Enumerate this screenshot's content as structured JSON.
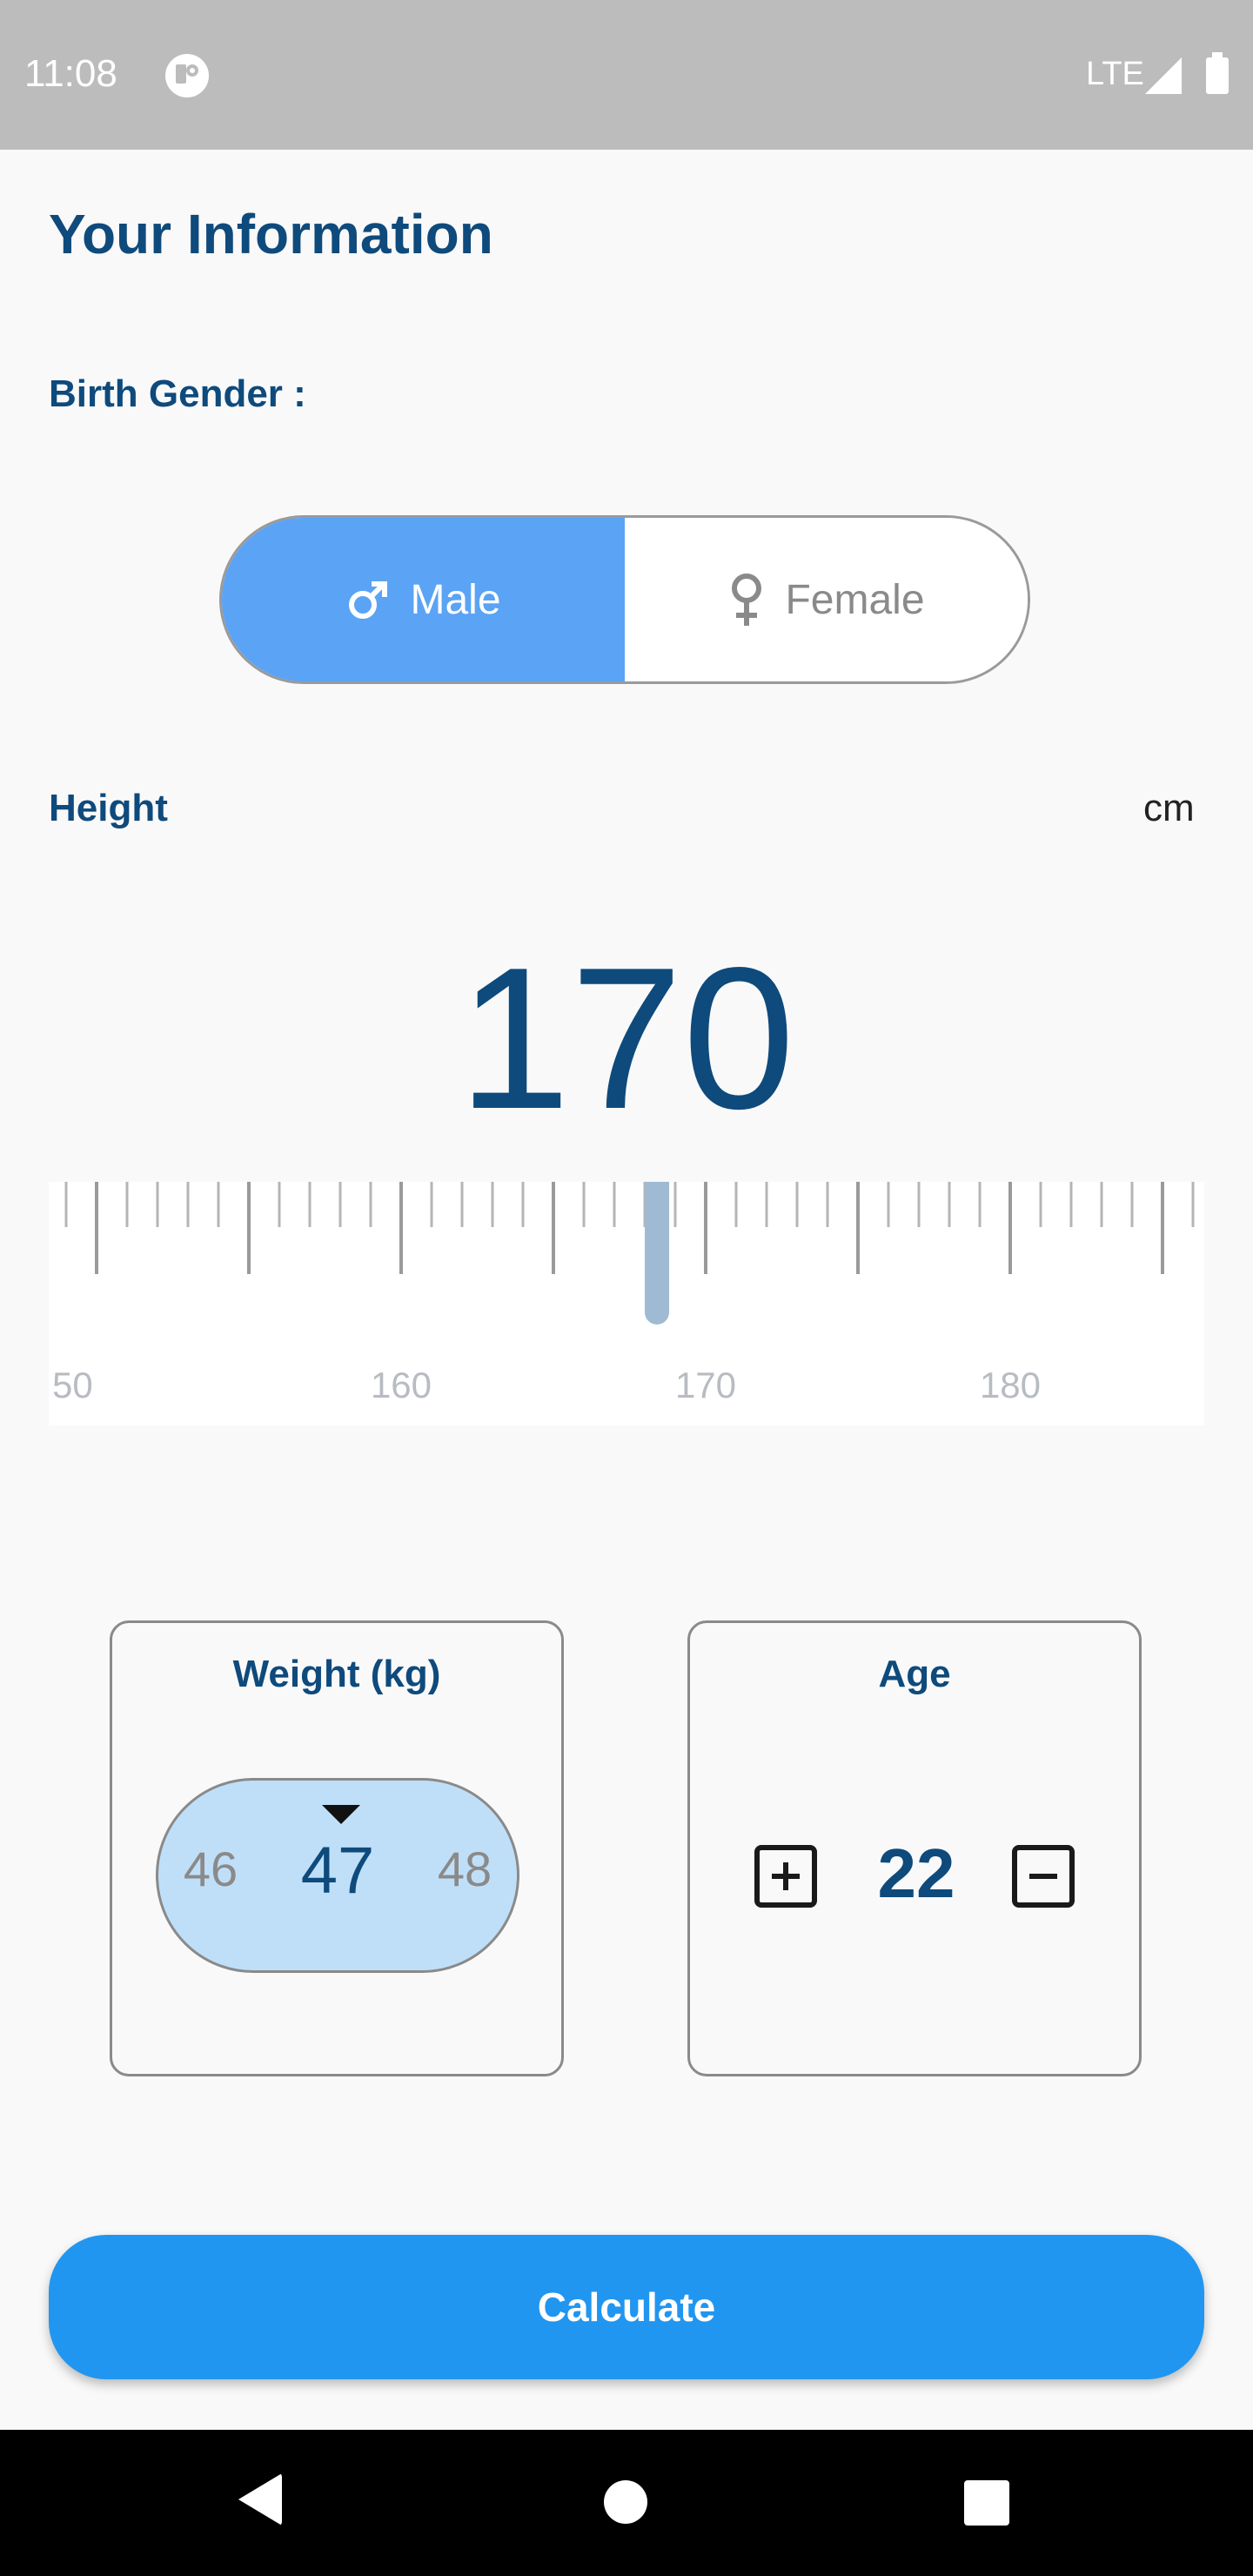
{
  "status_bar": {
    "time": "11:08",
    "network": "LTE",
    "icons": [
      "app-notification-icon",
      "signal-icon",
      "battery-icon"
    ]
  },
  "page": {
    "title": "Your Information"
  },
  "gender": {
    "label": "Birth Gender :",
    "selected": "Male",
    "options": [
      {
        "label": "Male",
        "icon": "male-symbol-icon"
      },
      {
        "label": "Female",
        "icon": "female-symbol-icon"
      }
    ]
  },
  "height": {
    "label": "Height",
    "unit": "cm",
    "value": "170",
    "ruler": {
      "first_tick": 149,
      "last_tick": 186,
      "major_every": 5,
      "labeled_every": 10,
      "labels": [
        "50",
        "160",
        "170",
        "180"
      ],
      "indicator_value": 168
    }
  },
  "weight": {
    "label": "Weight (kg)",
    "previous": "46",
    "current": "47",
    "next": "48"
  },
  "age": {
    "label": "Age",
    "value": "22",
    "increase_icon": "plus-box-icon",
    "decrease_icon": "minus-box-icon"
  },
  "actions": {
    "calculate_label": "Calculate"
  },
  "nav_bar": {
    "icons": [
      "back-icon",
      "home-icon",
      "recents-icon"
    ]
  },
  "colors": {
    "brand_dark": "#0e4a7c",
    "toggle_selected": "#5ba3f5",
    "picker_fill": "#bfdff9",
    "button": "#2196f0",
    "ruler_indicator": "#9fbbd4"
  }
}
